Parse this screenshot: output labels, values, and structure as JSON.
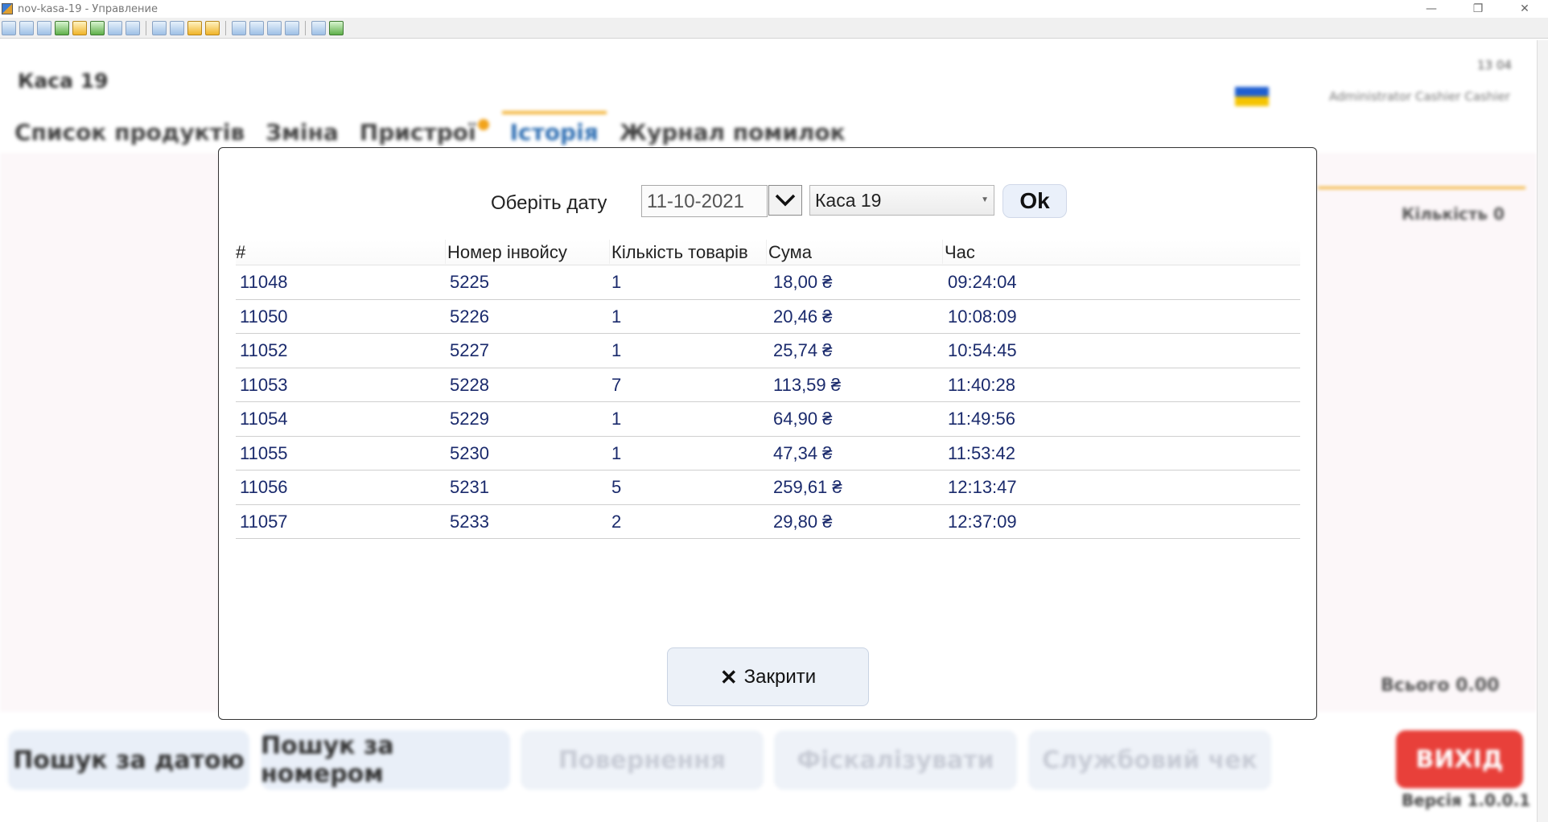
{
  "window": {
    "title": "nov-kasa-19 - Управление",
    "minimize_icon": "minimize-icon",
    "restore_icon": "restore-icon",
    "close_icon": "close-icon"
  },
  "background": {
    "register_title": "Каса 19",
    "clock": "13 04",
    "user": "Administrator  Cashier Cashier",
    "tabs": [
      {
        "label": "Список продуктів"
      },
      {
        "label": "Зміна"
      },
      {
        "label": "Пристрої"
      },
      {
        "label": "Історія"
      },
      {
        "label": "Журнал помилок"
      }
    ],
    "quantity": "Кількість  0",
    "total": "Всього  0.00",
    "bottom_buttons": [
      {
        "label": "Пошук за датою"
      },
      {
        "label": "Пошук за номером"
      },
      {
        "label": "Повернення"
      },
      {
        "label": "Фіскалізувати"
      },
      {
        "label": "Службовий чек"
      }
    ],
    "exit_label": "ВИХІД",
    "version": "Версія 1.0.0.1"
  },
  "modal": {
    "date_label": "Оберіть дату",
    "date_value": "11-10-2021",
    "register_select": "Каса 19",
    "ok_label": "Ok",
    "close_label": "Закрити",
    "columns": [
      "#",
      "Номер інвойсу",
      "Кількість товарів",
      "Сума",
      "Час"
    ],
    "rows": [
      {
        "id": "11048",
        "invoice": "5225",
        "items": "1",
        "sum": "18,00 ₴",
        "time": "09:24:04"
      },
      {
        "id": "11050",
        "invoice": "5226",
        "items": "1",
        "sum": "20,46 ₴",
        "time": "10:08:09"
      },
      {
        "id": "11052",
        "invoice": "5227",
        "items": "1",
        "sum": "25,74 ₴",
        "time": "10:54:45"
      },
      {
        "id": "11053",
        "invoice": "5228",
        "items": "7",
        "sum": "113,59 ₴",
        "time": "11:40:28"
      },
      {
        "id": "11054",
        "invoice": "5229",
        "items": "1",
        "sum": "64,90 ₴",
        "time": "11:49:56"
      },
      {
        "id": "11055",
        "invoice": "5230",
        "items": "1",
        "sum": "47,34 ₴",
        "time": "11:53:42"
      },
      {
        "id": "11056",
        "invoice": "5231",
        "items": "5",
        "sum": "259,61 ₴",
        "time": "12:13:47"
      },
      {
        "id": "11057",
        "invoice": "5233",
        "items": "2",
        "sum": "29,80 ₴",
        "time": "12:37:09"
      }
    ]
  },
  "colors": {
    "accent_orange": "#f2b233",
    "exit_red": "#e8403a",
    "table_text": "#1a2a6c",
    "button_bg": "#ecf1f8"
  }
}
